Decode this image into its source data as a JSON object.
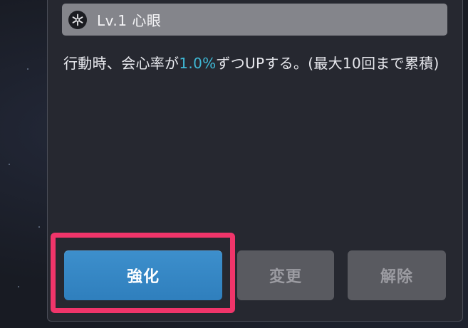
{
  "skill": {
    "name": "Lv.1 心眼",
    "icon": "snowflake-icon"
  },
  "description": {
    "before": "行動時、会心率が",
    "highlight": "1.0%",
    "after": "ずつUPする。(最大10回まで累積)"
  },
  "buttons": {
    "enhance_label": "強化",
    "change_label": "変更",
    "remove_label": "解除"
  },
  "colors": {
    "highlight": "#3fb9d6",
    "primary_button": "#3a8bc9",
    "focus_ring": "#f0356a",
    "disabled_button": "#595a60"
  }
}
